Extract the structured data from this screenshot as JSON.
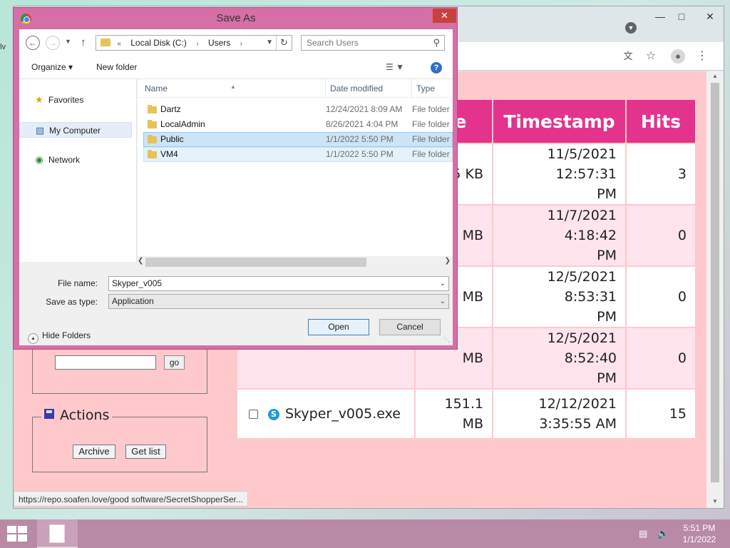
{
  "browser": {
    "status_url": "https://repo.soafen.love/good software/SecretShopperSer...",
    "icons": {
      "translate": "translate-icon",
      "star": "bookmark-star-icon",
      "profile": "profile-icon",
      "menu": "kebab-menu-icon"
    },
    "side_label": "lv"
  },
  "table": {
    "headers": {
      "size": "ze",
      "timestamp": "Timestamp",
      "hits": "Hits"
    },
    "rows": [
      {
        "name": "",
        "size": "5 KB",
        "ts1": "11/5/2021 12:57:31",
        "ts2": "PM",
        "hits": "3"
      },
      {
        "name": "",
        "size": "MB",
        "ts1": "11/7/2021 4:18:42",
        "ts2": "PM",
        "hits": "0"
      },
      {
        "name": "",
        "size": "MB",
        "ts1": "12/5/2021 8:53:31",
        "ts2": "PM",
        "hits": "0"
      },
      {
        "name": "",
        "size": "MB",
        "ts1": "12/5/2021 8:52:40",
        "ts2": "PM",
        "hits": "0"
      },
      {
        "name": "Skyper_v005.exe",
        "size": "151.1 MB",
        "ts1": "12/12/2021",
        "ts2": "3:35:55 AM",
        "hits": "15"
      }
    ],
    "colors": {
      "header": "#e3338c",
      "row_alt": "#ffe4ed",
      "page_bg": "#ffc9cc"
    }
  },
  "sidebar": {
    "go_label": "go",
    "actions_title": "Actions",
    "archive_label": "Archive",
    "getlist_label": "Get list"
  },
  "dialog": {
    "title": "Save As",
    "close": "✕",
    "breadcrumb": {
      "prefix": "«",
      "drive": "Local Disk (C:)",
      "folder": "Users"
    },
    "search_placeholder": "Search Users",
    "organize": "Organize ▾",
    "new_folder": "New folder",
    "nav": {
      "favorites": "Favorites",
      "computer": "My Computer",
      "network": "Network"
    },
    "columns": {
      "name": "Name",
      "date": "Date modified",
      "type": "Type"
    },
    "files": [
      {
        "name": "Dartz",
        "date": "12/24/2021 8:09 AM",
        "type": "File folder"
      },
      {
        "name": "LocalAdmin",
        "date": "8/26/2021 4:04 PM",
        "type": "File folder"
      },
      {
        "name": "Public",
        "date": "1/1/2022 5:50 PM",
        "type": "File folder"
      },
      {
        "name": "VM4",
        "date": "1/1/2022 5:50 PM",
        "type": "File folder"
      }
    ],
    "file_name_label": "File name:",
    "file_name_value": "Skyper_v005",
    "save_type_label": "Save as type:",
    "save_type_value": "Application",
    "hide_folders": "Hide Folders",
    "open_label": "Open",
    "cancel_label": "Cancel",
    "frame_color": "#d66fa6"
  },
  "taskbar": {
    "time": "5:51 PM",
    "date": "1/1/2022",
    "color": "#b98aa6"
  }
}
